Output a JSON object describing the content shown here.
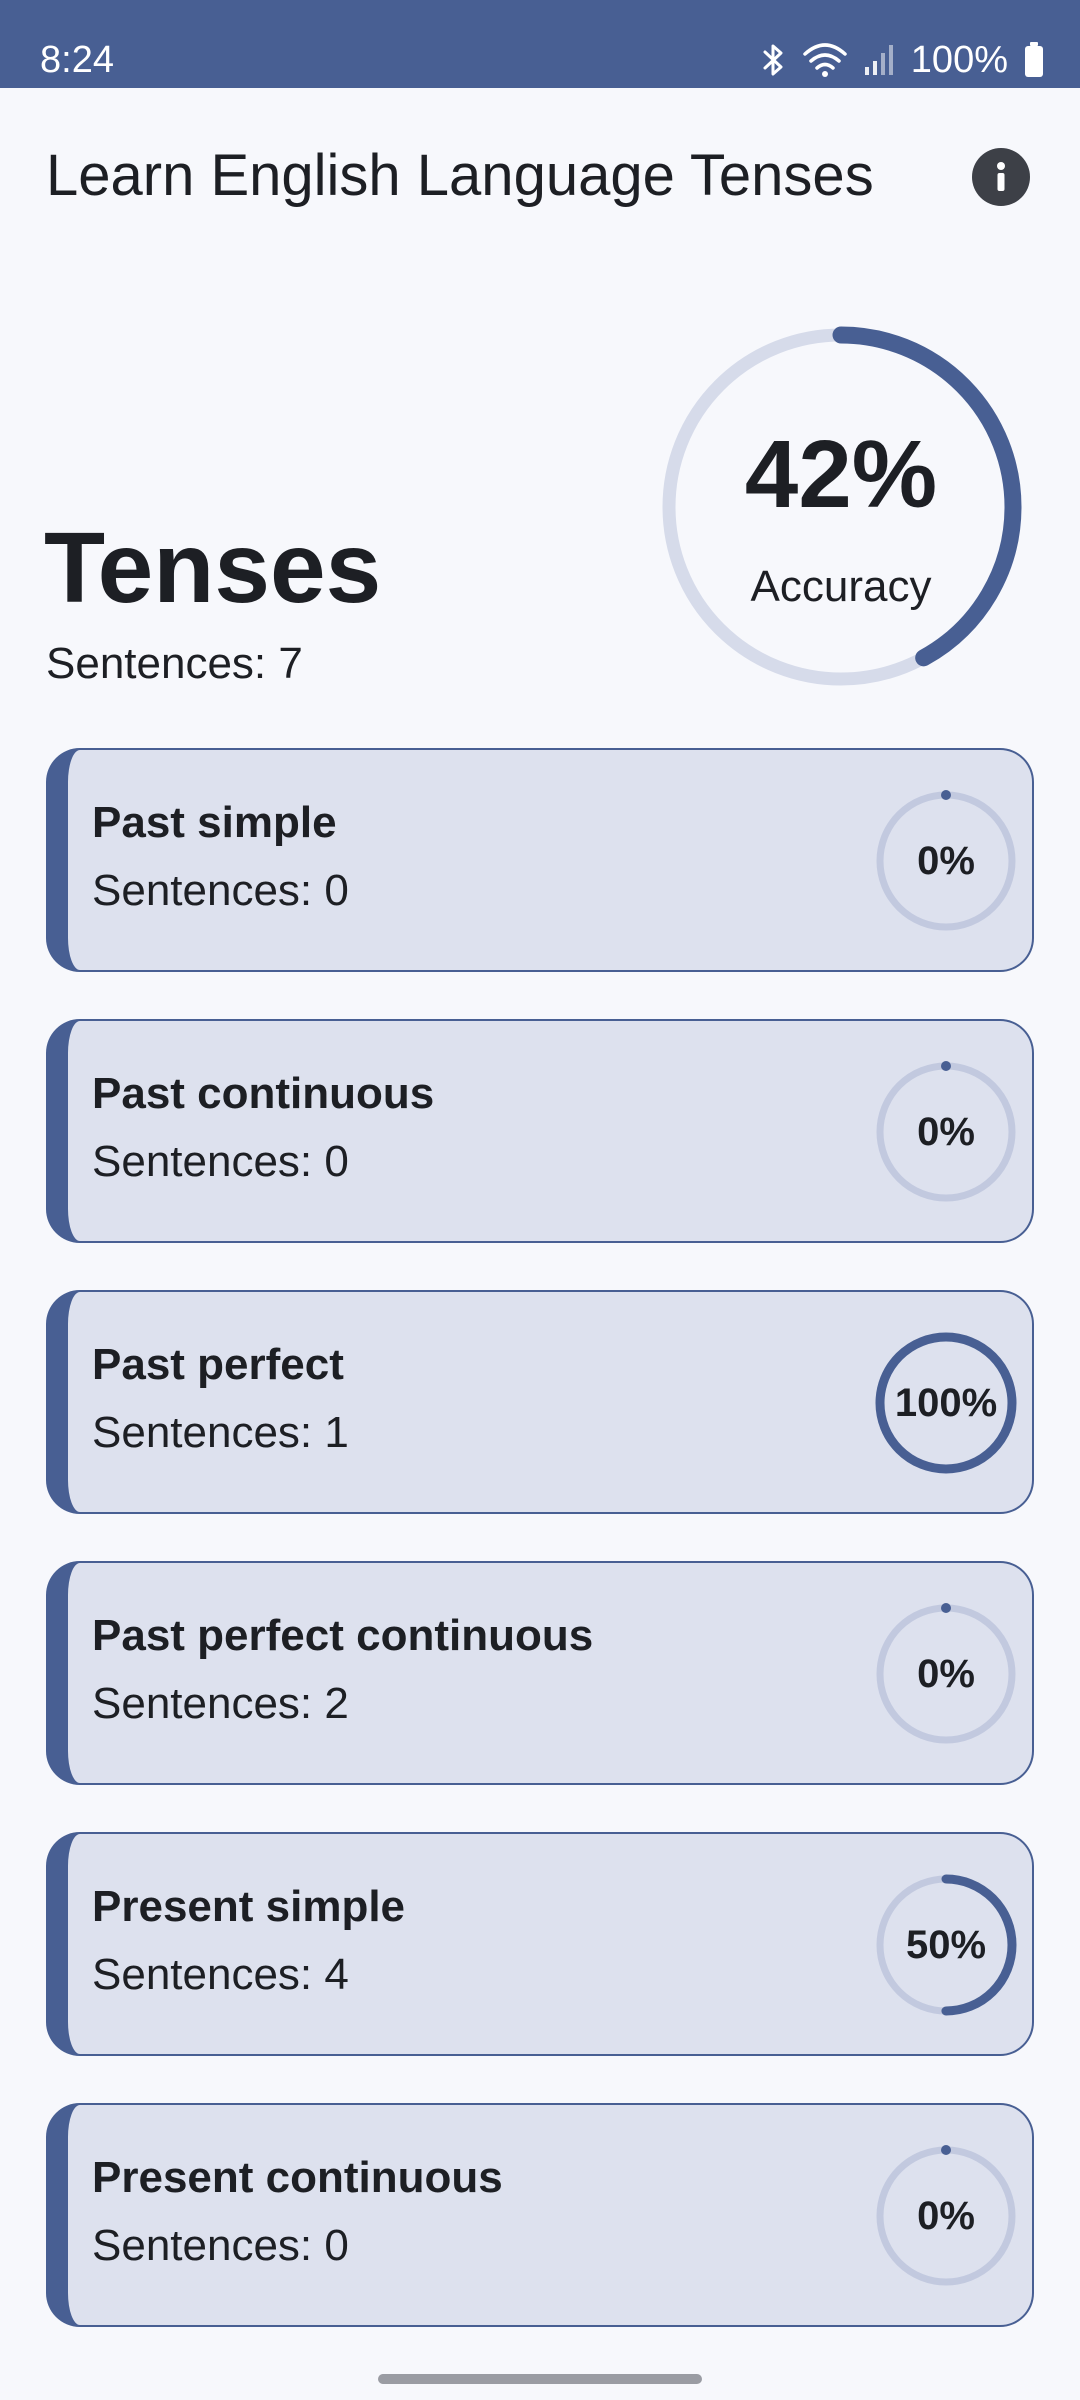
{
  "status_bar": {
    "time": "8:24",
    "battery": "100%",
    "icons": [
      "bluetooth-icon",
      "wifi-icon",
      "signal-icon",
      "battery-icon"
    ]
  },
  "app_bar": {
    "title": "Learn English Language Tenses",
    "info_icon": "info-icon"
  },
  "summary": {
    "title": "Tenses",
    "sentences_text": "Sentences: 7",
    "accuracy_value": "42%",
    "accuracy_fraction": 0.42,
    "accuracy_label": "Accuracy"
  },
  "tenses": [
    {
      "name": "Past simple",
      "sentences": "Sentences: 0",
      "percent_text": "0%",
      "fraction": 0
    },
    {
      "name": "Past continuous",
      "sentences": "Sentences: 0",
      "percent_text": "0%",
      "fraction": 0
    },
    {
      "name": "Past perfect",
      "sentences": "Sentences: 1",
      "percent_text": "100%",
      "fraction": 1
    },
    {
      "name": "Past perfect continuous",
      "sentences": "Sentences: 2",
      "percent_text": "0%",
      "fraction": 0
    },
    {
      "name": "Present simple",
      "sentences": "Sentences: 4",
      "percent_text": "50%",
      "fraction": 0.5
    },
    {
      "name": "Present continuous",
      "sentences": "Sentences: 0",
      "percent_text": "0%",
      "fraction": 0
    }
  ],
  "colors": {
    "primary": "#485f93",
    "track_big": "#d6dbea",
    "track_small": "#c2c9df",
    "card_bg": "#dde1ee",
    "page_bg": "#f7f8fc"
  }
}
